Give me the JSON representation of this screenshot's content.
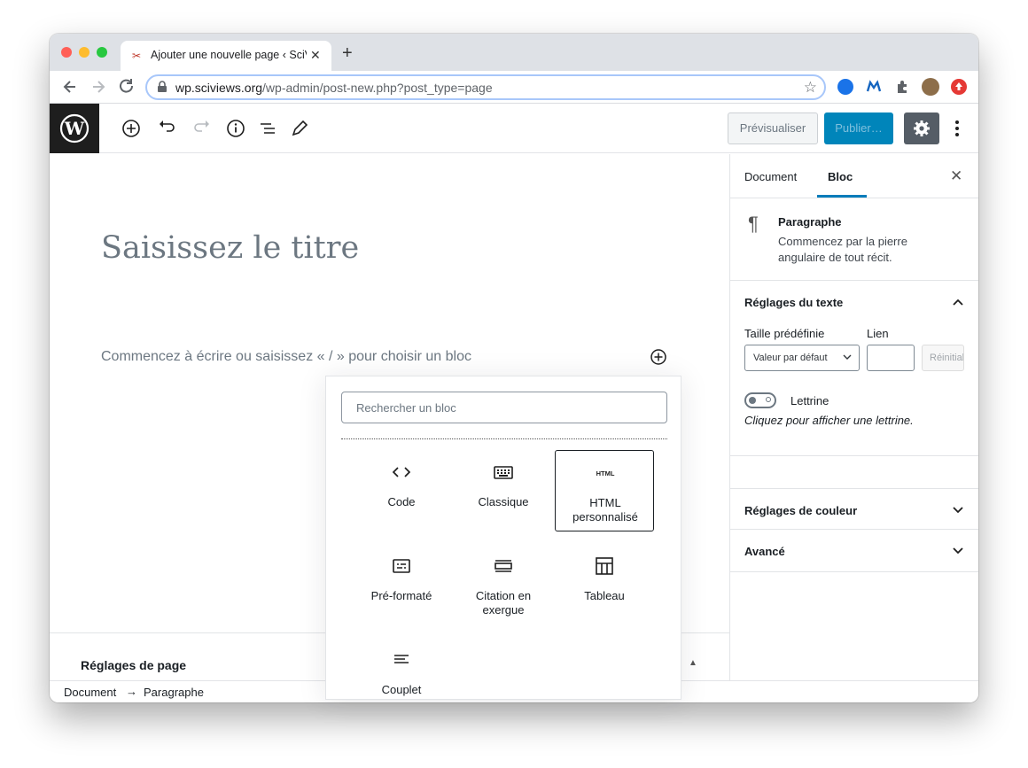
{
  "browser": {
    "tab_title": "Ajouter une nouvelle page ‹ SciViews",
    "url_host": "wp.sciviews.org",
    "url_path": "/wp-admin/post-new.php?post_type=page"
  },
  "wp_header": {
    "preview_label": "Prévisualiser",
    "publish_label": "Publier…"
  },
  "editor": {
    "title_placeholder": "Saisissez le titre",
    "paragraph_placeholder": "Commencez à écrire ou saisissez « / » pour choisir un bloc",
    "page_settings_label": "Réglages de page"
  },
  "breadcrumb": {
    "root": "Document",
    "arrow": "→",
    "current": "Paragraphe"
  },
  "sidebar": {
    "tabs": [
      {
        "label": "Document"
      },
      {
        "label": "Bloc"
      }
    ],
    "block_card": {
      "icon": "¶",
      "title": "Paragraphe",
      "description": "Commencez par la pierre angulaire de tout récit."
    },
    "text_settings": {
      "title": "Réglages du texte",
      "size_label": "Taille prédéfinie",
      "size_value": "Valeur par défaut",
      "link_label": "Lien",
      "reset_label": "Réinitialiser",
      "dropcap_label": "Lettrine",
      "dropcap_help": "Cliquez pour afficher une lettrine."
    },
    "color_settings_title": "Réglages de couleur",
    "advanced_title": "Avancé"
  },
  "inserter": {
    "search_placeholder": "Rechercher un bloc",
    "blocks": [
      {
        "name": "Code",
        "icon": "code-icon"
      },
      {
        "name": "Classique",
        "icon": "keyboard-icon"
      },
      {
        "name": "HTML personnalisé",
        "icon": "html-icon",
        "icon_text": "HTML",
        "selected": true
      },
      {
        "name": "Pré-formaté",
        "icon": "preformatted-icon"
      },
      {
        "name": "Citation en exergue",
        "icon": "pullquote-icon"
      },
      {
        "name": "Tableau",
        "icon": "table-icon"
      },
      {
        "name": "Couplet",
        "icon": "verse-icon"
      }
    ]
  },
  "colors": {
    "accent": "#007cba",
    "publish": "#0085ba",
    "wp_logo_bg": "#1e1e1e"
  }
}
